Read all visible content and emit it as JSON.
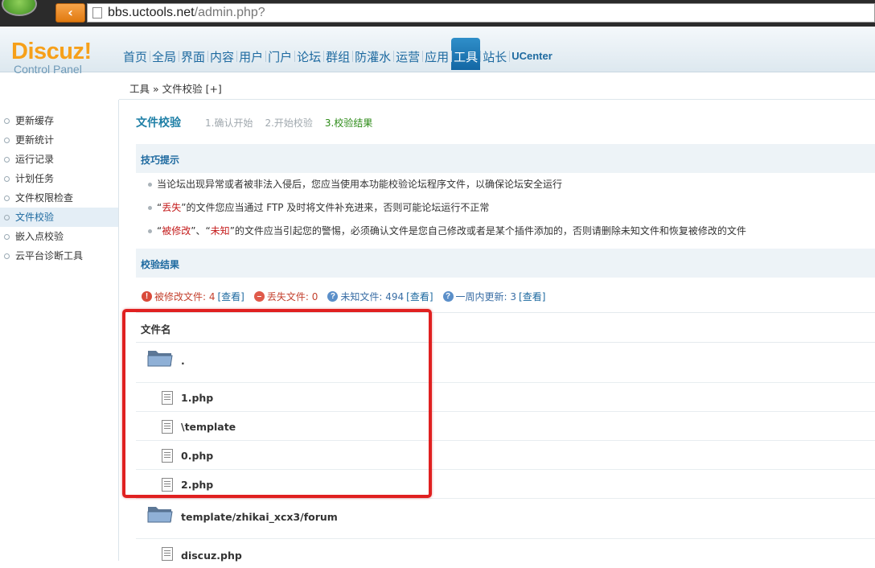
{
  "browser": {
    "url_host": "bbs.uctools.net",
    "url_path": "/admin.php?"
  },
  "brand": {
    "name": "Discuz!",
    "subtitle": "Control Panel"
  },
  "topnav": {
    "tabs": [
      {
        "label": "首页"
      },
      {
        "label": "全局"
      },
      {
        "label": "界面"
      },
      {
        "label": "内容"
      },
      {
        "label": "用户"
      },
      {
        "label": "门户"
      },
      {
        "label": "论坛"
      },
      {
        "label": "群组"
      },
      {
        "label": "防灌水"
      },
      {
        "label": "运营"
      },
      {
        "label": "应用"
      },
      {
        "label": "工具"
      },
      {
        "label": "站长"
      },
      {
        "label": "UCenter"
      }
    ],
    "active_tab": "工具"
  },
  "breadcrumb": "工具 » 文件校验 [+]",
  "sidebar": {
    "items": [
      {
        "label": "更新缓存"
      },
      {
        "label": "更新统计"
      },
      {
        "label": "运行记录"
      },
      {
        "label": "计划任务"
      },
      {
        "label": "文件权限检查"
      },
      {
        "label": "文件校验"
      },
      {
        "label": "嵌入点校验"
      },
      {
        "label": "云平台诊断工具"
      }
    ],
    "active_item": "文件校验"
  },
  "main": {
    "title": "文件校验",
    "steps": [
      "1.确认开始",
      "2.开始校验",
      "3.校验结果"
    ],
    "tips_heading": "技巧提示",
    "tips": {
      "tip1": "当论坛出现异常或者被非法入侵后，您应当使用本功能校验论坛程序文件，以确保论坛安全运行",
      "tip2_q1": "“",
      "tip2_red": "丢失",
      "tip2_rest": "”的文件您应当通过 FTP 及时将文件补充进来，否则可能论坛运行不正常",
      "tip3_q1": "“",
      "tip3_red1": "被修改",
      "tip3_mid": "”、“",
      "tip3_red2": "未知",
      "tip3_rest": "”的文件应当引起您的警惕，必须确认文件是您自己修改或者是某个插件添加的，否则请删除未知文件和恢复被修改的文件"
    },
    "results_heading": "校验结果",
    "summary": {
      "modified": "被修改文件: 4",
      "missing": "丢失文件: 0",
      "unknown": "未知文件: 494",
      "week": "一周内更新: 3",
      "view": "[查看]"
    },
    "table": {
      "column": "文件名",
      "rows": [
        {
          "name": ".",
          "type": "folder"
        },
        {
          "name": "1.php",
          "type": "file"
        },
        {
          "name": "\\template",
          "type": "file"
        },
        {
          "name": "0.php",
          "type": "file"
        },
        {
          "name": "2.php",
          "type": "file"
        },
        {
          "name": "template/zhikai_xcx3/forum",
          "type": "folder"
        },
        {
          "name": "discuz.php",
          "type": "file"
        }
      ]
    }
  },
  "colors": {
    "accent": "#1367a4",
    "brand_orange": "#f6a01a",
    "highlight": "#e02020",
    "step_current": "#2b8a16"
  }
}
